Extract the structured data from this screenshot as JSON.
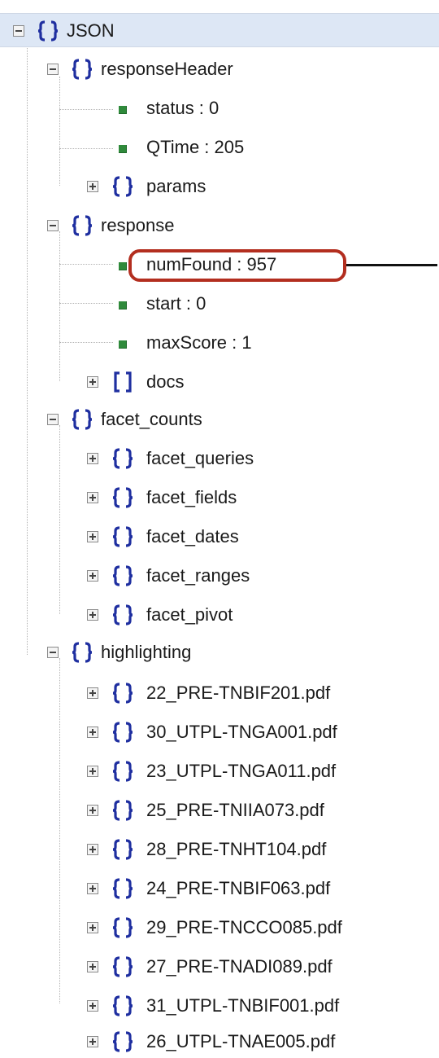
{
  "tree": {
    "root_label": "JSON",
    "responseHeader": {
      "label": "responseHeader",
      "status": "status : 0",
      "qtime": "QTime : 205",
      "params": "params"
    },
    "response": {
      "label": "response",
      "numFound": "numFound : 957",
      "start": "start : 0",
      "maxScore": "maxScore : 1",
      "docs": "docs"
    },
    "facet_counts": {
      "label": "facet_counts",
      "items": [
        "facet_queries",
        "facet_fields",
        "facet_dates",
        "facet_ranges",
        "facet_pivot"
      ]
    },
    "highlighting": {
      "label": "highlighting",
      "items": [
        "22_PRE-TNBIF201.pdf",
        "30_UTPL-TNGA001.pdf",
        "23_UTPL-TNGA011.pdf",
        "25_PRE-TNIIA073.pdf",
        "28_PRE-TNHT104.pdf",
        "24_PRE-TNBIF063.pdf",
        "29_PRE-TNCCO085.pdf",
        "27_PRE-TNADI089.pdf",
        "31_UTPL-TNBIF001.pdf",
        "26_UTPL-TNAE005.pdf"
      ]
    }
  },
  "colors": {
    "bracket_icon": "#1f2fa0",
    "leaf_icon": "#2f8a3b",
    "selection": "#dde7f5",
    "highlight_border": "#b32e1f"
  }
}
